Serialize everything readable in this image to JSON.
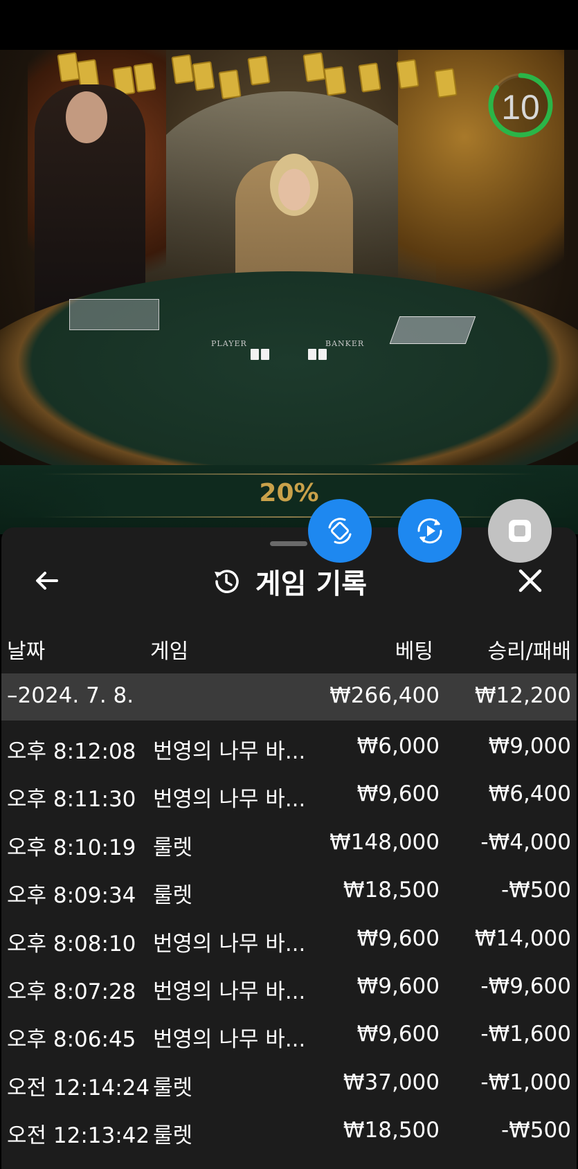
{
  "stream": {
    "countdown": "10",
    "countdown_fraction": 0.85,
    "table_labels": [
      "PLAYER",
      "BANKER"
    ],
    "percentage": "20%"
  },
  "floating_buttons": [
    {
      "icon": "rotate-screen-icon",
      "color": "#1e88f0"
    },
    {
      "icon": "replay-video-icon",
      "color": "#1e88f0"
    },
    {
      "icon": "stop-icon",
      "color": "#c2c2c2"
    }
  ],
  "header": {
    "title": "게임 기록",
    "back_icon": "arrow-left-icon",
    "history_icon": "history-icon",
    "close_icon": "close-icon"
  },
  "table": {
    "columns": {
      "date": "날짜",
      "game": "게임",
      "bet": "베팅",
      "result": "승리/패배"
    },
    "date_group": {
      "date": "–2024. 7. 8.",
      "bet": "₩266,400",
      "result": "₩12,200"
    },
    "rows": [
      {
        "time": "오후 8:12:08",
        "game": "번영의 나무 바...",
        "bet": "₩6,000",
        "result": "₩9,000"
      },
      {
        "time": "오후 8:11:30",
        "game": "번영의 나무 바...",
        "bet": "₩9,600",
        "result": "₩6,400"
      },
      {
        "time": "오후 8:10:19",
        "game": "룰렛",
        "bet": "₩148,000",
        "result": "-₩4,000"
      },
      {
        "time": "오후 8:09:34",
        "game": "룰렛",
        "bet": "₩18,500",
        "result": "-₩500"
      },
      {
        "time": "오후 8:08:10",
        "game": "번영의 나무 바...",
        "bet": "₩9,600",
        "result": "₩14,000"
      },
      {
        "time": "오후 8:07:28",
        "game": "번영의 나무 바...",
        "bet": "₩9,600",
        "result": "-₩9,600"
      },
      {
        "time": "오후 8:06:45",
        "game": "번영의 나무 바...",
        "bet": "₩9,600",
        "result": "-₩1,600"
      },
      {
        "time": "오전 12:14:24",
        "game": "룰렛",
        "bet": "₩37,000",
        "result": "-₩1,000"
      },
      {
        "time": "오전 12:13:42",
        "game": "룰렛",
        "bet": "₩18,500",
        "result": "-₩500"
      }
    ]
  }
}
